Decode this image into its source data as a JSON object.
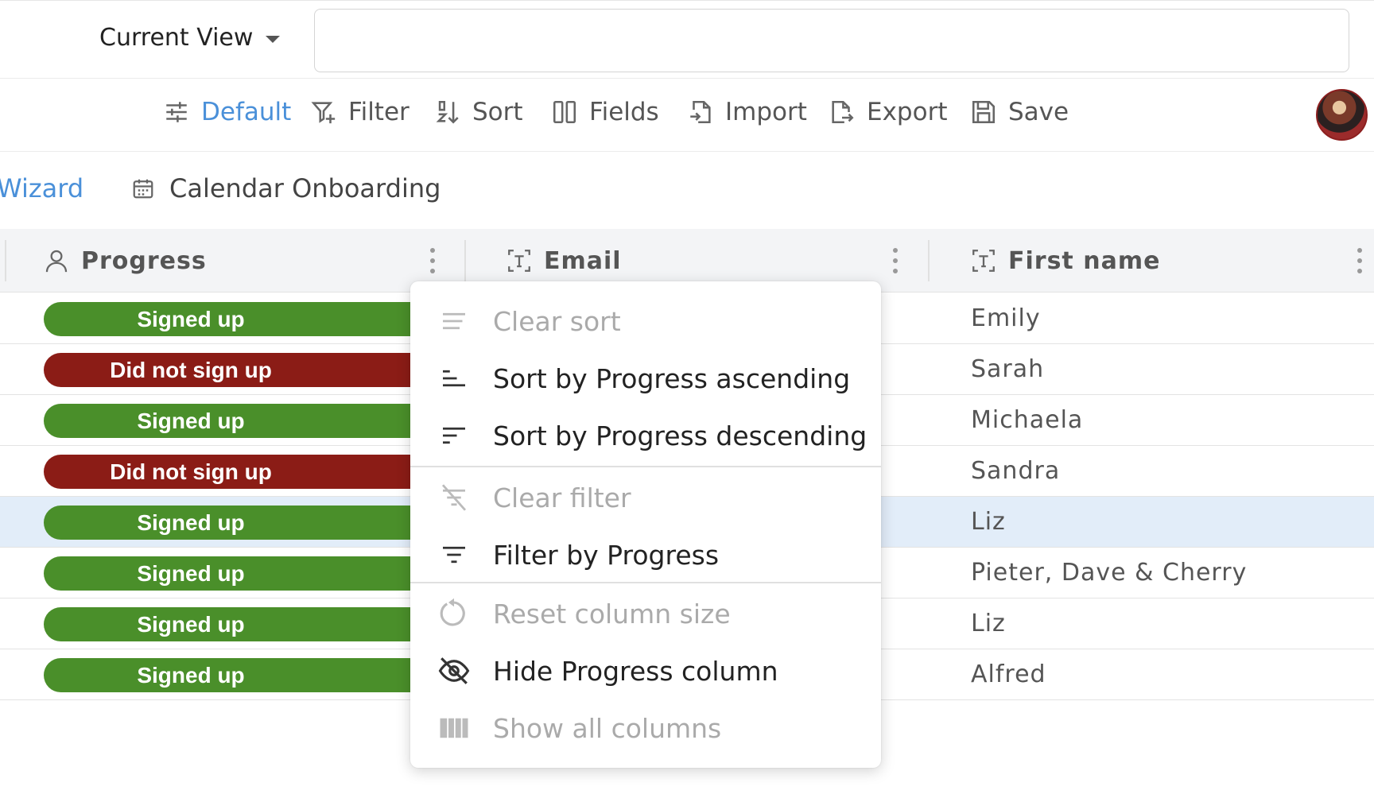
{
  "view": {
    "current_view_label": "Current View",
    "input_value": ""
  },
  "toolbar": {
    "items": [
      {
        "label": "Default",
        "icon": "sliders-icon",
        "active": true
      },
      {
        "label": "Filter",
        "icon": "filter-add-icon"
      },
      {
        "label": "Sort",
        "icon": "sort-icon"
      },
      {
        "label": "Fields",
        "icon": "columns-icon"
      },
      {
        "label": "Import",
        "icon": "file-import-icon"
      },
      {
        "label": "Export",
        "icon": "file-export-icon"
      },
      {
        "label": "Save",
        "icon": "floppy-disk-icon"
      }
    ]
  },
  "tabs": [
    {
      "label": "Wizard",
      "active": true
    },
    {
      "label": "Calendar Onboarding",
      "icon": "calendar-icon"
    }
  ],
  "table": {
    "columns": [
      {
        "label": "Progress",
        "icon": "person-icon"
      },
      {
        "label": "Email",
        "icon": "text-field-icon"
      },
      {
        "label": "First name",
        "icon": "text-field-icon"
      }
    ],
    "rows": [
      {
        "progress": "Signed up",
        "status": "success",
        "first_name": "Emily"
      },
      {
        "progress": "Did not sign up",
        "status": "danger",
        "first_name": "Sarah"
      },
      {
        "progress": "Signed up",
        "status": "success",
        "first_name": "Michaela"
      },
      {
        "progress": "Did not sign up",
        "status": "danger",
        "first_name": "Sandra"
      },
      {
        "progress": "Signed up",
        "status": "success",
        "first_name": "Liz",
        "selected": true
      },
      {
        "progress": "Signed up",
        "status": "success",
        "first_name": "Pieter, Dave & Cherry"
      },
      {
        "progress": "Signed up",
        "status": "success",
        "first_name": "Liz"
      },
      {
        "progress": "Signed up",
        "status": "success",
        "first_name": "Alfred"
      }
    ]
  },
  "column_menu": {
    "items": [
      {
        "label": "Clear sort",
        "icon": "clear-sort-icon",
        "disabled": true
      },
      {
        "label": "Sort by Progress ascending",
        "icon": "sort-ascending-icon",
        "disabled": false
      },
      {
        "label": "Sort by Progress descending",
        "icon": "sort-descending-icon",
        "disabled": false
      },
      {
        "label": "Clear filter",
        "icon": "clear-filter-icon",
        "disabled": true
      },
      {
        "label": "Filter by Progress",
        "icon": "filter-icon",
        "disabled": false
      },
      {
        "label": "Reset column size",
        "icon": "reset-icon",
        "disabled": true
      },
      {
        "label": "Hide Progress column",
        "icon": "eye-off-icon",
        "disabled": false
      },
      {
        "label": "Show all columns",
        "icon": "show-columns-icon",
        "disabled": true
      }
    ]
  },
  "colors": {
    "accent": "#4a90d9",
    "success": "#4a8f2a",
    "danger": "#8b1c16",
    "selected_row": "#e2edf9",
    "header_bg": "#f3f4f6"
  }
}
